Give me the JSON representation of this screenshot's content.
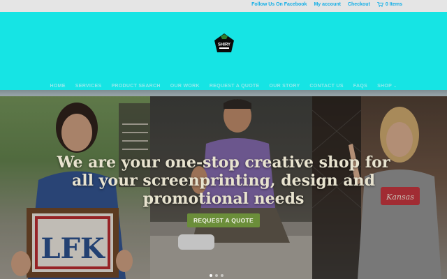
{
  "topbar": {
    "facebook": "Follow Us On Facebook",
    "account": "My account",
    "checkout": "Checkout",
    "cart": "0 Items",
    "cart_icon": "cart-icon"
  },
  "brand": {
    "logo_text": "SHIRY",
    "colors": {
      "header_bg": "#16e4e4",
      "topbar_bg": "#e5e5e5",
      "link": "#12aee6",
      "cta_bg": "#6b8e3a"
    }
  },
  "nav": {
    "items": [
      {
        "label": "HOME"
      },
      {
        "label": "SERVICES"
      },
      {
        "label": "PRODUCT SEARCH"
      },
      {
        "label": "OUR WORK"
      },
      {
        "label": "REQUEST A QUOTE"
      },
      {
        "label": "OUR STORY"
      },
      {
        "label": "CONTACT US"
      },
      {
        "label": "FAQS"
      },
      {
        "label": "SHOP"
      }
    ]
  },
  "hero": {
    "headline": "We are your one-stop creative shop for all your screenprinting, design and promotional needs",
    "cta": "REQUEST A QUOTE",
    "sign_text": "LFK",
    "shirt_text": "Kansas"
  }
}
